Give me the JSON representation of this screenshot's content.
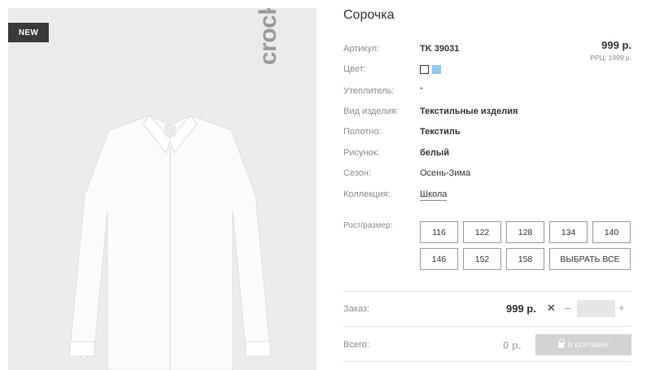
{
  "image": {
    "badge": "NEW",
    "brand": "crockid"
  },
  "product": {
    "title": "Сорочка",
    "price": "999 р.",
    "rrp": "РРЦ: 1999 р."
  },
  "attributes": [
    {
      "label": "Артикул:",
      "value": "TK 39031"
    },
    {
      "label": "Цвет:",
      "value": ""
    },
    {
      "label": "Утеплитель:",
      "value": "\""
    },
    {
      "label": "Вид изделия:",
      "value": "Текстильные изделия"
    },
    {
      "label": "Полотно:",
      "value": "Текстиль"
    },
    {
      "label": "Рисунок:",
      "value": "белый"
    },
    {
      "label": "Сезон:",
      "value": "Осень-Зима"
    },
    {
      "label": "Коллекция:",
      "value": "Школа"
    }
  ],
  "colors": [
    {
      "name": "white-swatch",
      "hex": "#ffffff"
    },
    {
      "name": "blue-swatch",
      "hex": "#8ec8f0"
    }
  ],
  "sizes": {
    "label": "Рост/размер:",
    "options": [
      "116",
      "122",
      "128",
      "134",
      "140",
      "146",
      "152",
      "158"
    ],
    "select_all": "ВЫБРАТЬ ВСЕ"
  },
  "order": {
    "label": "Заказ:",
    "price": "999 р.",
    "times": "✕",
    "minus": "–",
    "plus": "+",
    "quantity": ""
  },
  "total": {
    "label": "Всего:",
    "value": "0 р.",
    "cart_button": "В КОРЗИНУ"
  }
}
